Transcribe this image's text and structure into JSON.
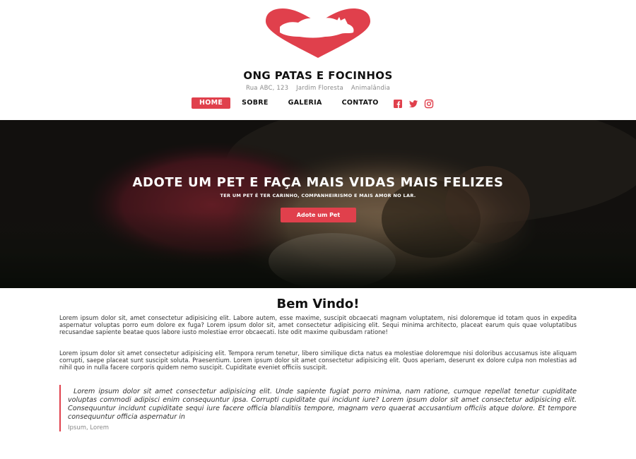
{
  "header": {
    "logo_icon": "heart-pets-logo",
    "title": "ONG PATAS E FOCINHOS",
    "address": [
      "Rua ABC, 123",
      "Jardim Floresta",
      "Animalândia"
    ]
  },
  "nav": {
    "items": [
      {
        "label": "HOME",
        "active": true
      },
      {
        "label": "SOBRE"
      },
      {
        "label": "GALERIA"
      },
      {
        "label": "CONTATO"
      }
    ],
    "social_icons": [
      "facebook-icon",
      "twitter-icon",
      "instagram-icon"
    ]
  },
  "hero": {
    "title": "ADOTE UM PET E FAÇA MAIS VIDAS MAIS FELIZES",
    "subtitle": "TER UM PET É TER CARINHO, COMPANHEIRISMO E MAIS AMOR NO LAR.",
    "button_label": "Adote um Pet"
  },
  "main": {
    "heading": "Bem Vindo!",
    "paragraph1": "Lorem ipsum dolor sit, amet consectetur adipisicing elit. Labore autem, esse maxime, suscipit obcaecati magnam voluptatem, nisi doloremque id totam quos in expedita aspernatur voluptas porro eum dolore ex fuga? Lorem ipsum dolor sit, amet consectetur adipisicing elit. Sequi minima architecto, placeat earum quis quae voluptatibus recusandae sapiente beatae quos labore iusto molestiae error obcaecati. Iste odit maxime quibusdam ratione!",
    "paragraph2": "Lorem ipsum dolor sit amet consectetur adipisicing elit. Tempora rerum tenetur, libero similique dicta natus ea molestiae doloremque nisi doloribus accusamus iste aliquam corrupti, saepe placeat sunt suscipit soluta. Praesentium. Lorem ipsum dolor sit amet consectetur adipisicing elit. Quos aperiam, deserunt ex dolore culpa non molestias ad nihil quo in nulla facere corporis quidem nemo suscipit. Cupiditate eveniet officiis suscipit.",
    "quote": "Lorem ipsum dolor sit amet consectetur adipisicing elit. Unde sapiente fugiat porro minima, nam ratione, cumque repellat tenetur cupiditate voluptas commodi adipisci enim consequuntur ipsa. Corrupti cupiditate qui incidunt iure? Lorem ipsum dolor sit amet consectetur adipisicing elit. Consequuntur incidunt cupiditate sequi iure facere officia blanditiis tempore, magnam vero quaerat accusantium officiis atque dolore. Et tempore consequuntur officia aspernatur in",
    "quote_cite": "Ipsum, Lorem"
  },
  "colors": {
    "accent": "#e0404c",
    "text": "#333333",
    "muted": "#8a8a8a"
  }
}
